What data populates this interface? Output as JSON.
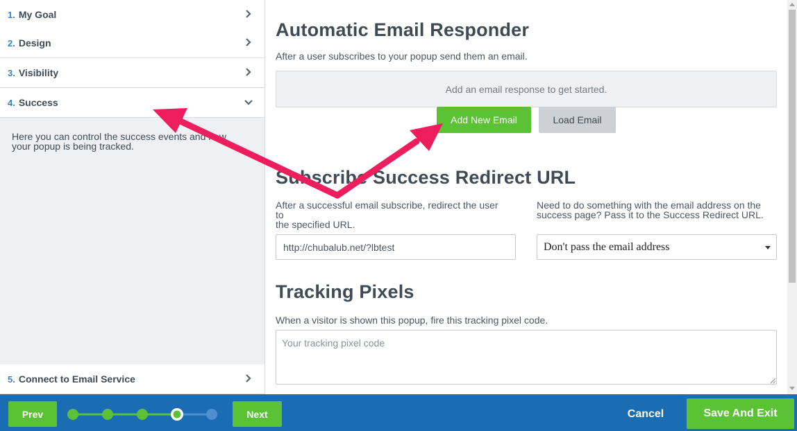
{
  "sidebar": {
    "steps": [
      {
        "num": "1.",
        "label": "My Goal"
      },
      {
        "num": "2.",
        "label": "Design"
      },
      {
        "num": "3.",
        "label": "Visibility"
      },
      {
        "num": "4.",
        "label": "Success"
      },
      {
        "num": "5.",
        "label": "Connect to Email Service"
      }
    ],
    "active_description": "Here you can control the success events and how your popup is being tracked."
  },
  "responder": {
    "title": "Automatic Email Responder",
    "subtitle": "After a user subscribes to your popup send them an email.",
    "empty_message": "Add an email response to get started.",
    "add_button": "Add New Email",
    "load_button": "Load Email"
  },
  "redirect": {
    "title": "Subscribe Success Redirect URL",
    "left_text_line1": "After a successful email subscribe, redirect the user",
    "left_text_line2": "to",
    "left_text_line3": "the specified URL.",
    "right_text_line1": "Need to do something with the email address on the",
    "right_text_line2": "success page? Pass it to the Success Redirect URL.",
    "url_value": "http://chubalub.net/?lbtest",
    "pass_option": "Don't pass the email address"
  },
  "tracking": {
    "title": "Tracking Pixels",
    "subtitle": "When a visitor is shown this popup, fire this tracking pixel code.",
    "placeholder": "Your tracking pixel code"
  },
  "footer": {
    "prev": "Prev",
    "next": "Next",
    "cancel": "Cancel",
    "save": "Save And Exit",
    "progress": {
      "total_steps": 5,
      "current_step": 4
    }
  },
  "colors": {
    "accent_green": "#5bc236",
    "footer_blue": "#1a6db3",
    "annotation_arrow": "#ee1d5d",
    "step_number_blue": "#3a7fc4"
  }
}
